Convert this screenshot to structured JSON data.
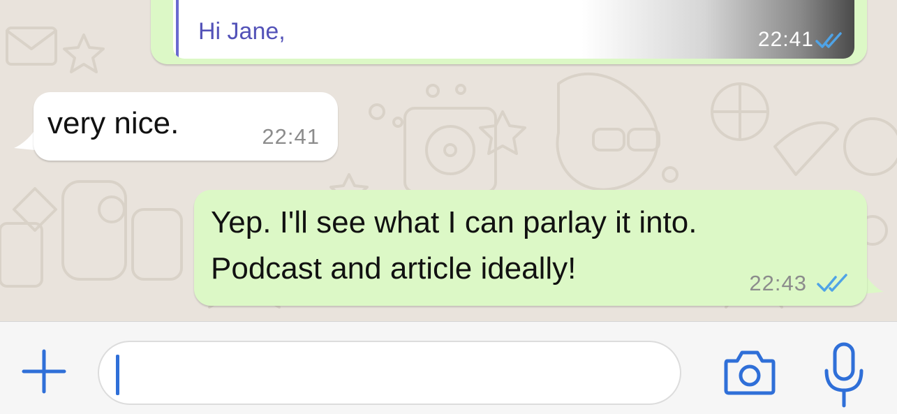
{
  "colors": {
    "accent": "#2f6fd8",
    "outgoing_bubble": "#dcf8c6",
    "incoming_bubble": "#ffffff",
    "read_ticks": "#4fa3e6",
    "wallpaper": "#e9e3dc"
  },
  "messages": [
    {
      "direction": "outgoing",
      "quoted": true,
      "text": "Hi Jane,",
      "time": "22:41",
      "status": "read"
    },
    {
      "direction": "incoming",
      "text": "very nice.",
      "time": "22:41"
    },
    {
      "direction": "outgoing",
      "lines": [
        "Yep. I'll see what I can parlay it into.",
        "Podcast and article ideally!"
      ],
      "time": "22:43",
      "status": "read"
    }
  ],
  "input_bar": {
    "message_value": "",
    "icons": [
      "plus-icon",
      "camera-icon",
      "microphone-icon"
    ]
  }
}
